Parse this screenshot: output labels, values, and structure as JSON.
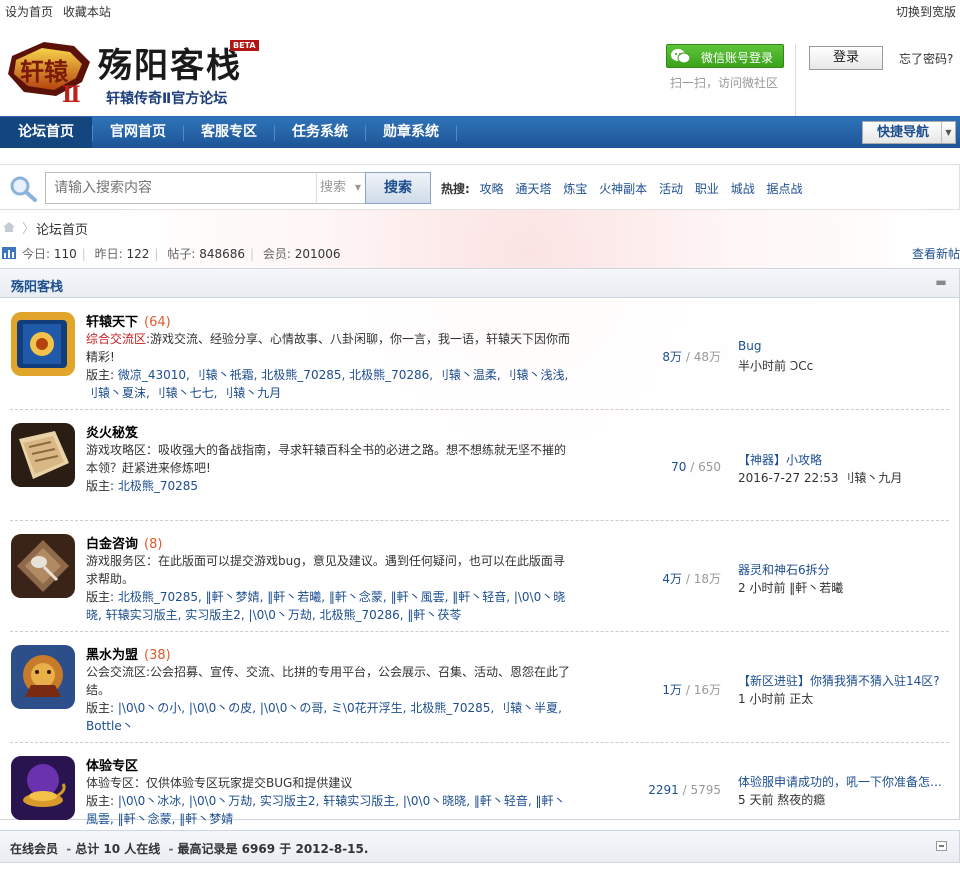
{
  "topbar": {
    "set_home": "设为首页",
    "bookmark": "收藏本站",
    "switch_wide": "切换到宽版"
  },
  "header": {
    "logo_title": "殇阳客栈",
    "beta": "BETA",
    "logo_sub": "轩辕传奇Ⅱ官方论坛",
    "wechat_login": "微信账号登录",
    "wechat_sub": "扫一扫，访问微社区",
    "login": "登录",
    "forgot": "忘了密码?"
  },
  "nav": {
    "items": [
      "论坛首页",
      "官网首页",
      "客服专区",
      "任务系统",
      "勋章系统"
    ],
    "quick_nav": "快捷导航"
  },
  "search": {
    "placeholder": "请输入搜索内容",
    "type": "搜索",
    "button": "搜索",
    "hot_label": "热搜:",
    "hot": [
      "攻略",
      "通天塔",
      "炼宝",
      "火神副本",
      "活动",
      "职业",
      "城战",
      "据点战"
    ]
  },
  "breadcrumb": {
    "current": "论坛首页"
  },
  "stats": {
    "today_label": "今日:",
    "today": "110",
    "yesterday_label": "昨日:",
    "yesterday": "122",
    "posts_label": "帖子:",
    "posts": "848686",
    "members_label": "会员:",
    "members": "201006",
    "new_posts": "查看新帖"
  },
  "category": {
    "title": "殇阳客栈"
  },
  "forums": [
    {
      "name": "轩辕天下",
      "count": "(64)",
      "tag": "综合交流区",
      "desc": ":游戏交流、经验分享、心情故事、八卦闲聊，你一言，我一语，轩辕天下因你而精彩!",
      "mods_label": "版主:",
      "mods": "微凉_43010, 刂辕丶祇霜, 北极熊_70285, 北极熊_70286, 刂辕丶温柔, 刂辕丶浅浅, 刂辕丶夏沫, 刂辕丶七七, 刂辕丶九月",
      "threads": "8万",
      "posts": "48万",
      "last_title": "Bug",
      "last_meta": "半小时前 ϽCc"
    },
    {
      "name": "炎火秘笈",
      "count": "",
      "tag": "",
      "desc": "游戏攻略区：吸收强大的备战指南，寻求轩辕百科全书的必进之路。想不想练就无坚不摧的本领？赶紧进来修炼吧!",
      "mods_label": "版主:",
      "mods": "北极熊_70285",
      "threads": "70",
      "posts": "650",
      "last_title": "【神器】小攻略",
      "last_meta": "2016-7-27 22:53 刂辕丶九月"
    },
    {
      "name": "白金咨询",
      "count": "(8)",
      "tag": "",
      "desc": "游戏服务区：在此版面可以提交游戏bug，意见及建议。遇到任何疑问，也可以在此版面寻求帮助。",
      "mods_label": "版主:",
      "mods": "北极熊_70285, ‖軒丶梦婧, ‖軒丶若曦, ‖軒丶念蒙, ‖軒丶風雲, ‖軒丶轻音, |\\0\\0丶晓晓, 轩辕实习版主, 实习版主2, |\\0\\0丶万劫, 北极熊_70286, ‖軒丶茯苓",
      "threads": "4万",
      "posts": "18万",
      "last_title": "器灵和神石6拆分",
      "last_meta": "2 小时前 ‖軒丶若曦"
    },
    {
      "name": "黑水为盟",
      "count": "(38)",
      "tag": "",
      "desc": "公会交流区:公会招募、宣传、交流、比拼的专用平台，公会展示、召集、活动、恩怨在此了结。",
      "mods_label": "版主:",
      "mods": "|\\0\\0丶の小, |\\0\\0丶の皮, |\\0\\0丶の哥, ミ\\0花开浮生, 北极熊_70285, 刂辕丶半夏, Bottle丶",
      "threads": "1万",
      "posts": "16万",
      "last_title": "【新区进驻】你猜我猜不猜入驻14区?",
      "last_meta": "1 小时前 正太"
    },
    {
      "name": "体验专区",
      "count": "",
      "tag": "",
      "desc": "体验专区：仅供体验专区玩家提交BUG和提供建议",
      "mods_label": "版主:",
      "mods": "|\\0\\0丶冰冰, |\\0\\0丶万劫, 实习版主2, 轩辕实习版主, |\\0\\0丶晓晓, ‖軒丶轻音, ‖軒丶風雲, ‖軒丶念蒙, ‖軒丶梦婧",
      "threads": "2291",
      "posts": "5795",
      "last_title": "体验服申请成功的，吼一下你准备怎么玩",
      "last_meta": "5 天前 熬夜的瘾"
    }
  ],
  "online": {
    "label": "在线会员",
    "total": "总计",
    "count": "10",
    "unit": "人在线",
    "record_label": "最高记录是",
    "record": "6969",
    "on": "于",
    "date": "2012-8-15."
  }
}
